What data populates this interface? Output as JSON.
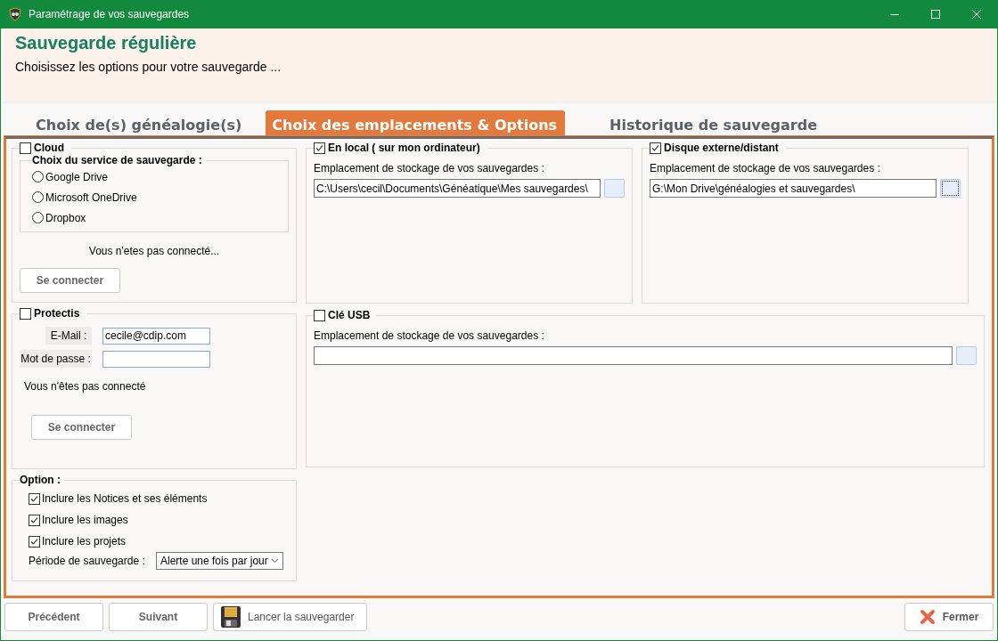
{
  "window": {
    "title": "Paramétrage de vos sauvegardes"
  },
  "header": {
    "title": "Sauvegarde régulière",
    "subtitle": "Choisissez les options pour votre sauvegarde ..."
  },
  "tabs": [
    {
      "label": "Choix de(s) généalogie(s)",
      "selected": false
    },
    {
      "label": "Choix des emplacements & Options",
      "selected": true
    },
    {
      "label": "Historique de sauvegarde",
      "selected": false
    }
  ],
  "cloud": {
    "label": "Cloud",
    "checked": false,
    "group_label": "Choix du service de sauvegarde :",
    "services": [
      {
        "label": "Google Drive",
        "selected": false
      },
      {
        "label": "Microsoft OneDrive",
        "selected": false
      },
      {
        "label": "Dropbox",
        "selected": false
      }
    ],
    "status": "Vous n'etes pas connecté...",
    "button": "Se connecter"
  },
  "local": {
    "label": "En local ( sur mon ordinateur)",
    "checked": true,
    "field_label": "Emplacement de stockage de vos sauvegardes :",
    "path": "C:\\Users\\cecil\\Documents\\Généatique\\Mes sauvegardes\\",
    "browse_focused": false
  },
  "external": {
    "label": "Disque externe/distant",
    "checked": true,
    "field_label": "Emplacement de stockage de vos sauvegardes :",
    "path": "G:\\Mon Drive\\généalogies et sauvegardes\\",
    "browse_focused": true
  },
  "protectis": {
    "label": "Protectis",
    "checked": false,
    "email_label": "E-Mail :",
    "email": "cecile@cdip.com",
    "password_label": "Mot de passe :",
    "status": "Vous n'êtes pas connecté",
    "button": "Se connecter"
  },
  "usb": {
    "label": "Clé USB",
    "checked": false,
    "field_label": "Emplacement de stockage de vos sauvegardes :",
    "browse_focused": false
  },
  "options": {
    "label": "Option :",
    "items": [
      {
        "label": "Inclure les Notices et ses éléments",
        "checked": true
      },
      {
        "label": "Inclure les images",
        "checked": true
      },
      {
        "label": "Inclure les projets",
        "checked": true
      }
    ],
    "period_label": "Période de sauvegarde :",
    "period_value": "Alerte une fois par jour"
  },
  "footer": [
    {
      "label": "Précédent",
      "kind": "nav"
    },
    {
      "label": "Suivant",
      "kind": "nav"
    },
    {
      "label": "Lancer la sauvegarder",
      "kind": "save"
    },
    {
      "label": "Fermer",
      "kind": "close"
    }
  ]
}
